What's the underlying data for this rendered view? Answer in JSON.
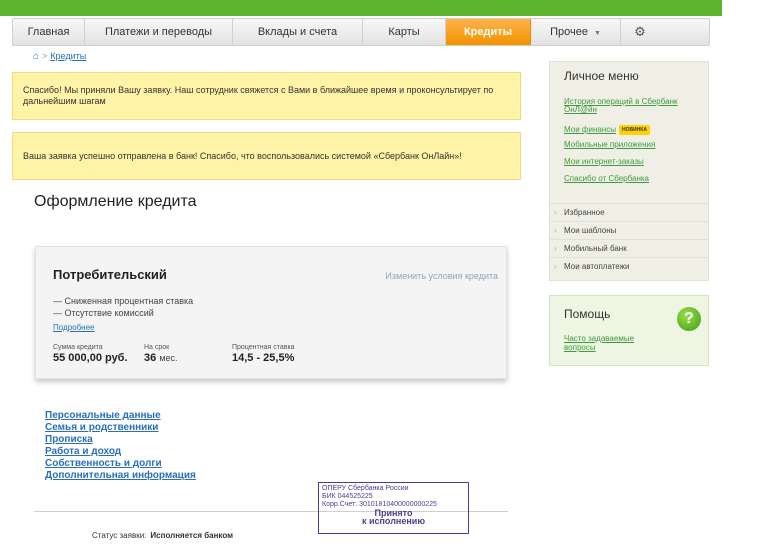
{
  "nav": {
    "items": [
      "Главная",
      "Платежи и переводы",
      "Вклады и счета",
      "Карты",
      "Кредиты",
      "Прочее",
      "⚙"
    ]
  },
  "breadcrumb": {
    "link": "Кредиты"
  },
  "notices": [
    "Спасибо! Мы приняли Вашу заявку. Наш сотрудник свяжется с Вами в ближайшее время и проконсультирует по дальнейшим шагам",
    "Ваша заявка успешно отправлена в банк! Спасибо, что воспользовались системой «Сбербанк ОнЛайн»!"
  ],
  "page_title": "Оформление кредита",
  "loan": {
    "title": "Потребительский",
    "change_link": "Изменить условия кредита",
    "features": [
      "— Сниженная процентная ставка",
      "— Отсутствие комиссий"
    ],
    "more_link": "Подробнее",
    "amount_label": "Сумма кредита",
    "amount_value": "55 000,00 руб.",
    "term_label": "На срок",
    "term_value": "36",
    "term_unit": "мес.",
    "rate_label": "Процентная ставка",
    "rate_value": "14,5 - 25,5%"
  },
  "sections": [
    "Персональные данные",
    "Семья и родственники",
    "Прописка",
    "Работа и доход",
    "Собственность и долги",
    "Дополнительная информация"
  ],
  "stamp": {
    "line1": "ОПЕРУ Сбербанка России",
    "line2": "БИК 044525225",
    "line3": "Корр.Счет: 30101810400000000225",
    "line4": "Принято",
    "line5": "к исполнению"
  },
  "status": {
    "label": "Статус заявки:",
    "value": "Исполняется банком"
  },
  "personal_menu": {
    "title": "Личное меню",
    "links": [
      "История операций в Сбербанк ОнЛ@йн",
      "Мои финансы",
      "Мобильные приложения",
      "Мои интернет-заказы",
      "Спасибо от Сбербанка"
    ],
    "badge": "НОВИНКА",
    "items": [
      "Избранное",
      "Мои шаблоны",
      "Мобильный банк",
      "Мои автоплатежи"
    ]
  },
  "help": {
    "title": "Помощь",
    "link": "Часто задаваемые вопросы",
    "icon": "?"
  },
  "colors": {
    "accent": "#f39200",
    "brand_green": "#5db52f",
    "notice": "#fff3a8",
    "link": "#2a6fb6"
  }
}
